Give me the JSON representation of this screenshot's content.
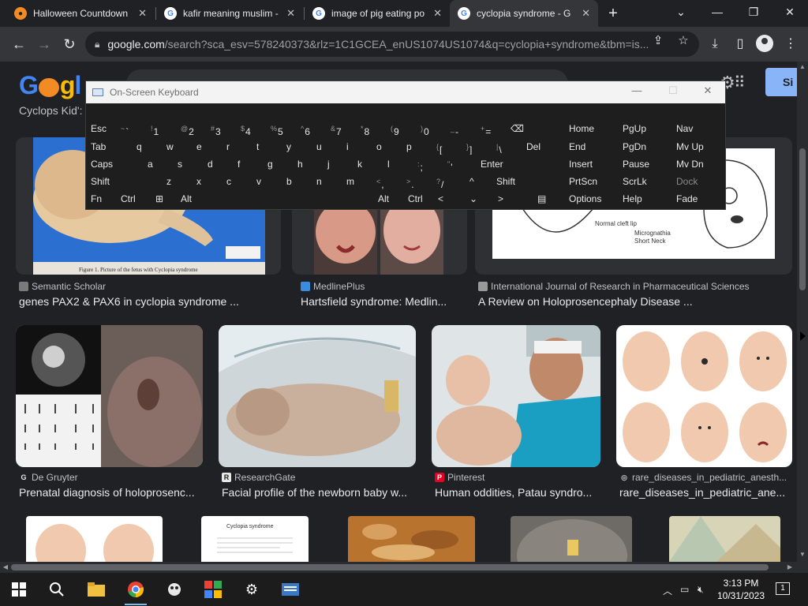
{
  "tabs": [
    {
      "title": "Halloween Countdown",
      "favicon": "pumpkin-icon",
      "color": "#f28b24"
    },
    {
      "title": "kafir meaning muslim -",
      "favicon": "google-icon",
      "color": "#4285f4"
    },
    {
      "title": "image of pig eating po",
      "favicon": "google-icon",
      "color": "#4285f4"
    },
    {
      "title": "cyclopia syndrome - G",
      "favicon": "google-icon",
      "color": "#4285f4",
      "active": true
    }
  ],
  "tab_close": "✕",
  "new_tab": "+",
  "window_controls": {
    "list": "⌄",
    "minimize": "—",
    "restore": "❐",
    "close": "✕"
  },
  "address": {
    "host": "google.com",
    "path": "/search?sca_esv=578240373&rlz=1C1GCEA_enUS1074US1074&q=cyclopia+syndrome&tbm=is..."
  },
  "google": {
    "logo_letters": [
      "G",
      "o",
      "g",
      "l"
    ],
    "signin": "Si"
  },
  "top_caption": "Cyclops Kid':",
  "results_row1": [
    {
      "source": "Semantic Scholar",
      "title": "genes PAX2 & PAX6 in cyclopia syndrome ...",
      "figure_caption": "Figure 1. Picture of the fetus with Cyclopia syndrome",
      "icon_color": "#7a7a7a"
    },
    {
      "source": "MedlinePlus",
      "title": "Hartsfield syndrome: Medlin...",
      "icon_color": "#3a8dde"
    },
    {
      "source": "International Journal of Research in Pharmaceutical Sciences",
      "title": "A Review on Holoprosencephaly Disease ...",
      "labels": [
        "Normal cleft lip",
        "Micrognathia",
        "Short Neck"
      ],
      "icon_color": "#9a9a9a"
    }
  ],
  "results_row2": [
    {
      "source": "De Gruyter",
      "title": "Prenatal diagnosis of holoprosenc...",
      "icon_color": "#e8e8e8"
    },
    {
      "source": "ResearchGate",
      "title": "Facial profile of the newborn baby w...",
      "icon_color": "#e8e8e8"
    },
    {
      "source": "Pinterest",
      "title": "Human oddities, Patau syndro...",
      "icon_color": "#e60023"
    },
    {
      "source": "rare_diseases_in_pediatric_anesth...",
      "title": "rare_diseases_in_pediatric_ane...",
      "icon_color": "#9a9a9a"
    }
  ],
  "results_row3_doc_title": "Cyclopia syndrome",
  "osk": {
    "title": "On-Screen Keyboard",
    "row1": [
      "Esc",
      "~",
      "!",
      "@",
      "#",
      "$",
      "%",
      "^",
      "&",
      "*",
      "(",
      ")",
      "_",
      "+",
      "⌫"
    ],
    "row1_main": [
      "`",
      "1",
      "2",
      "3",
      "4",
      "5",
      "6",
      "7",
      "8",
      "9",
      "0",
      "-",
      "="
    ],
    "row2": [
      "Tab",
      "q",
      "w",
      "e",
      "r",
      "t",
      "y",
      "u",
      "i",
      "o",
      "p",
      "[",
      "]",
      "\\",
      "Del"
    ],
    "row2_alt": [
      "{",
      "}",
      "|"
    ],
    "row3": [
      "Caps",
      "a",
      "s",
      "d",
      "f",
      "g",
      "h",
      "j",
      "k",
      "l",
      ";",
      "'",
      "Enter"
    ],
    "row3_alt": [
      ":",
      "\""
    ],
    "row4": [
      "Shift",
      "z",
      "x",
      "c",
      "v",
      "b",
      "n",
      "m",
      ",",
      ".",
      "/",
      "^",
      "Shift"
    ],
    "row4_alt": [
      "<",
      ">",
      "?"
    ],
    "row5": [
      "Fn",
      "Ctrl",
      "⊞",
      "Alt",
      "Alt",
      "Ctrl",
      "<",
      "⌄",
      ">",
      "▤"
    ],
    "nav": [
      "Home",
      "PgUp",
      "Nav",
      "End",
      "PgDn",
      "Mv Up",
      "Insert",
      "Pause",
      "Mv Dn",
      "PrtScn",
      "ScrLk",
      "Dock",
      "Options",
      "Help",
      "Fade"
    ]
  },
  "taskbar": {
    "time": "3:13 PM",
    "date": "10/31/2023",
    "notifications": "1"
  }
}
